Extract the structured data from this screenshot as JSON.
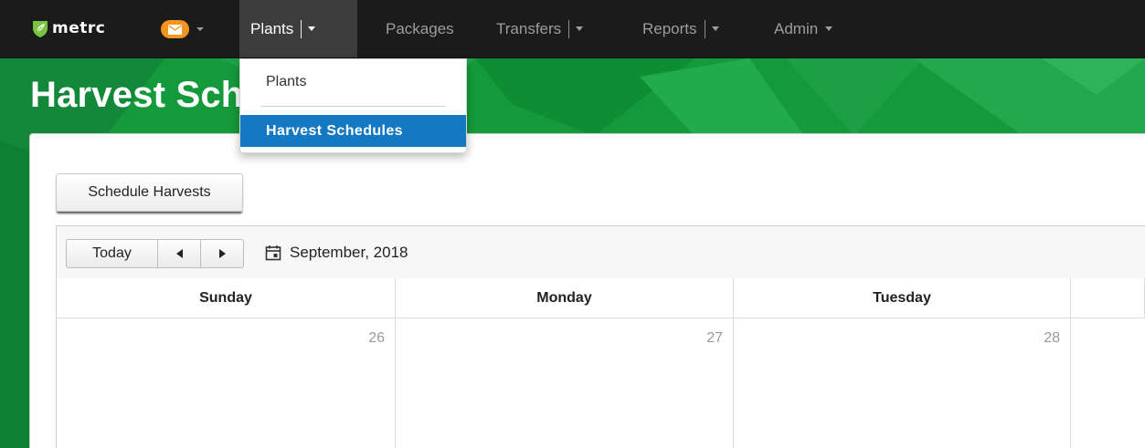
{
  "colors": {
    "navbar_bg": "#1b1b1b",
    "banner_green": "#159a3b",
    "mail_badge": "#f7941d",
    "menu_highlight": "#1578c2"
  },
  "brand": {
    "name": "metrc",
    "icon": "leaf-shield-icon"
  },
  "navbar": {
    "mail_icon": "envelope-icon",
    "items": [
      {
        "label": "Plants",
        "active": true,
        "has_dropdown": true
      },
      {
        "label": "Packages",
        "active": false,
        "has_dropdown": false
      },
      {
        "label": "Transfers",
        "active": false,
        "has_dropdown": true
      },
      {
        "label": "Reports",
        "active": false,
        "has_dropdown": true
      },
      {
        "label": "Admin",
        "active": false,
        "has_dropdown": true
      }
    ]
  },
  "dropdown": {
    "items": [
      {
        "label": "Plants",
        "selected": false
      },
      {
        "label": "Harvest Schedules",
        "selected": true
      }
    ]
  },
  "page": {
    "title": "Harvest Schedules"
  },
  "actions": {
    "schedule_label": "Schedule Harvests"
  },
  "calendar": {
    "today_label": "Today",
    "prev_icon": "triangle-left-icon",
    "next_icon": "triangle-right-icon",
    "month_icon": "calendar-icon",
    "month_label": "September, 2018",
    "days": [
      {
        "name": "Sunday",
        "date": "26"
      },
      {
        "name": "Monday",
        "date": "27"
      },
      {
        "name": "Tuesday",
        "date": "28"
      }
    ]
  }
}
